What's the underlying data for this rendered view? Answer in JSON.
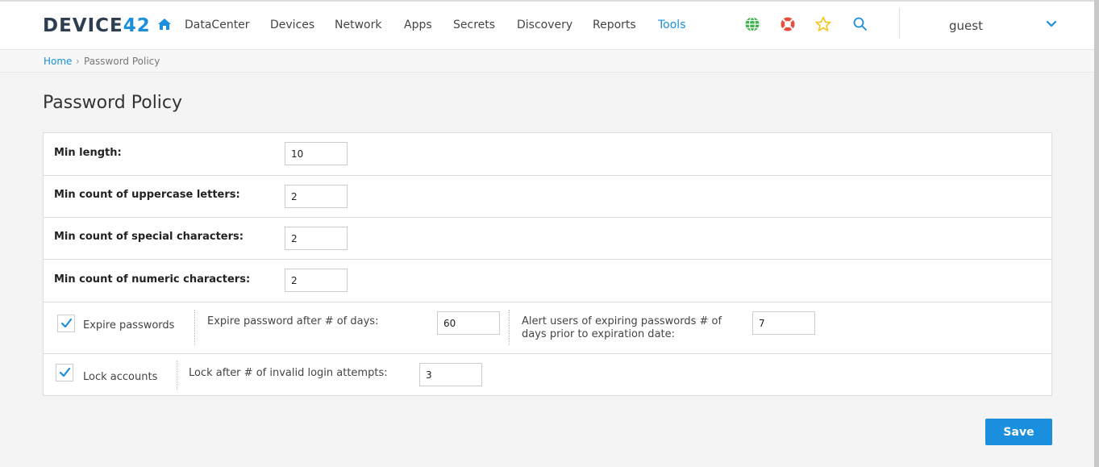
{
  "header": {
    "logo_text": "DEVICE",
    "logo_number": "42",
    "nav": [
      "DataCenter",
      "Devices",
      "Network",
      "Apps",
      "Secrets",
      "Discovery",
      "Reports",
      "Tools"
    ],
    "active_nav": "Tools",
    "icons": [
      "home-icon",
      "globe-icon",
      "lifebuoy-icon",
      "star-icon",
      "search-icon",
      "chevron-down-icon"
    ],
    "user": "guest",
    "colors": {
      "accent": "#1a8fdd",
      "globe": "#3cb44b",
      "lifebuoy": "#e74c3c",
      "star": "#f5c518"
    }
  },
  "breadcrumb": {
    "home": "Home",
    "separator": "›",
    "current": "Password Policy"
  },
  "page": {
    "title": "Password Policy"
  },
  "form": {
    "min_length": {
      "label": "Min length:",
      "value": "10"
    },
    "uppercase": {
      "label": "Min count of uppercase letters:",
      "value": "2"
    },
    "special": {
      "label": "Min count of special characters:",
      "value": "2"
    },
    "numeric": {
      "label": "Min count of numeric characters:",
      "value": "2"
    },
    "expire": {
      "checkbox_label": "Expire passwords",
      "checked": true,
      "days_label": "Expire password after # of days:",
      "days_value": "60",
      "alert_label_line1": "Alert users of expiring passwords # of",
      "alert_label_line2": "days prior to expiration date:",
      "alert_value": "7"
    },
    "lock": {
      "checkbox_label": "Lock accounts",
      "checked": true,
      "attempts_label": "Lock after # of invalid login attempts:",
      "attempts_value": "3"
    }
  },
  "actions": {
    "save": "Save"
  }
}
